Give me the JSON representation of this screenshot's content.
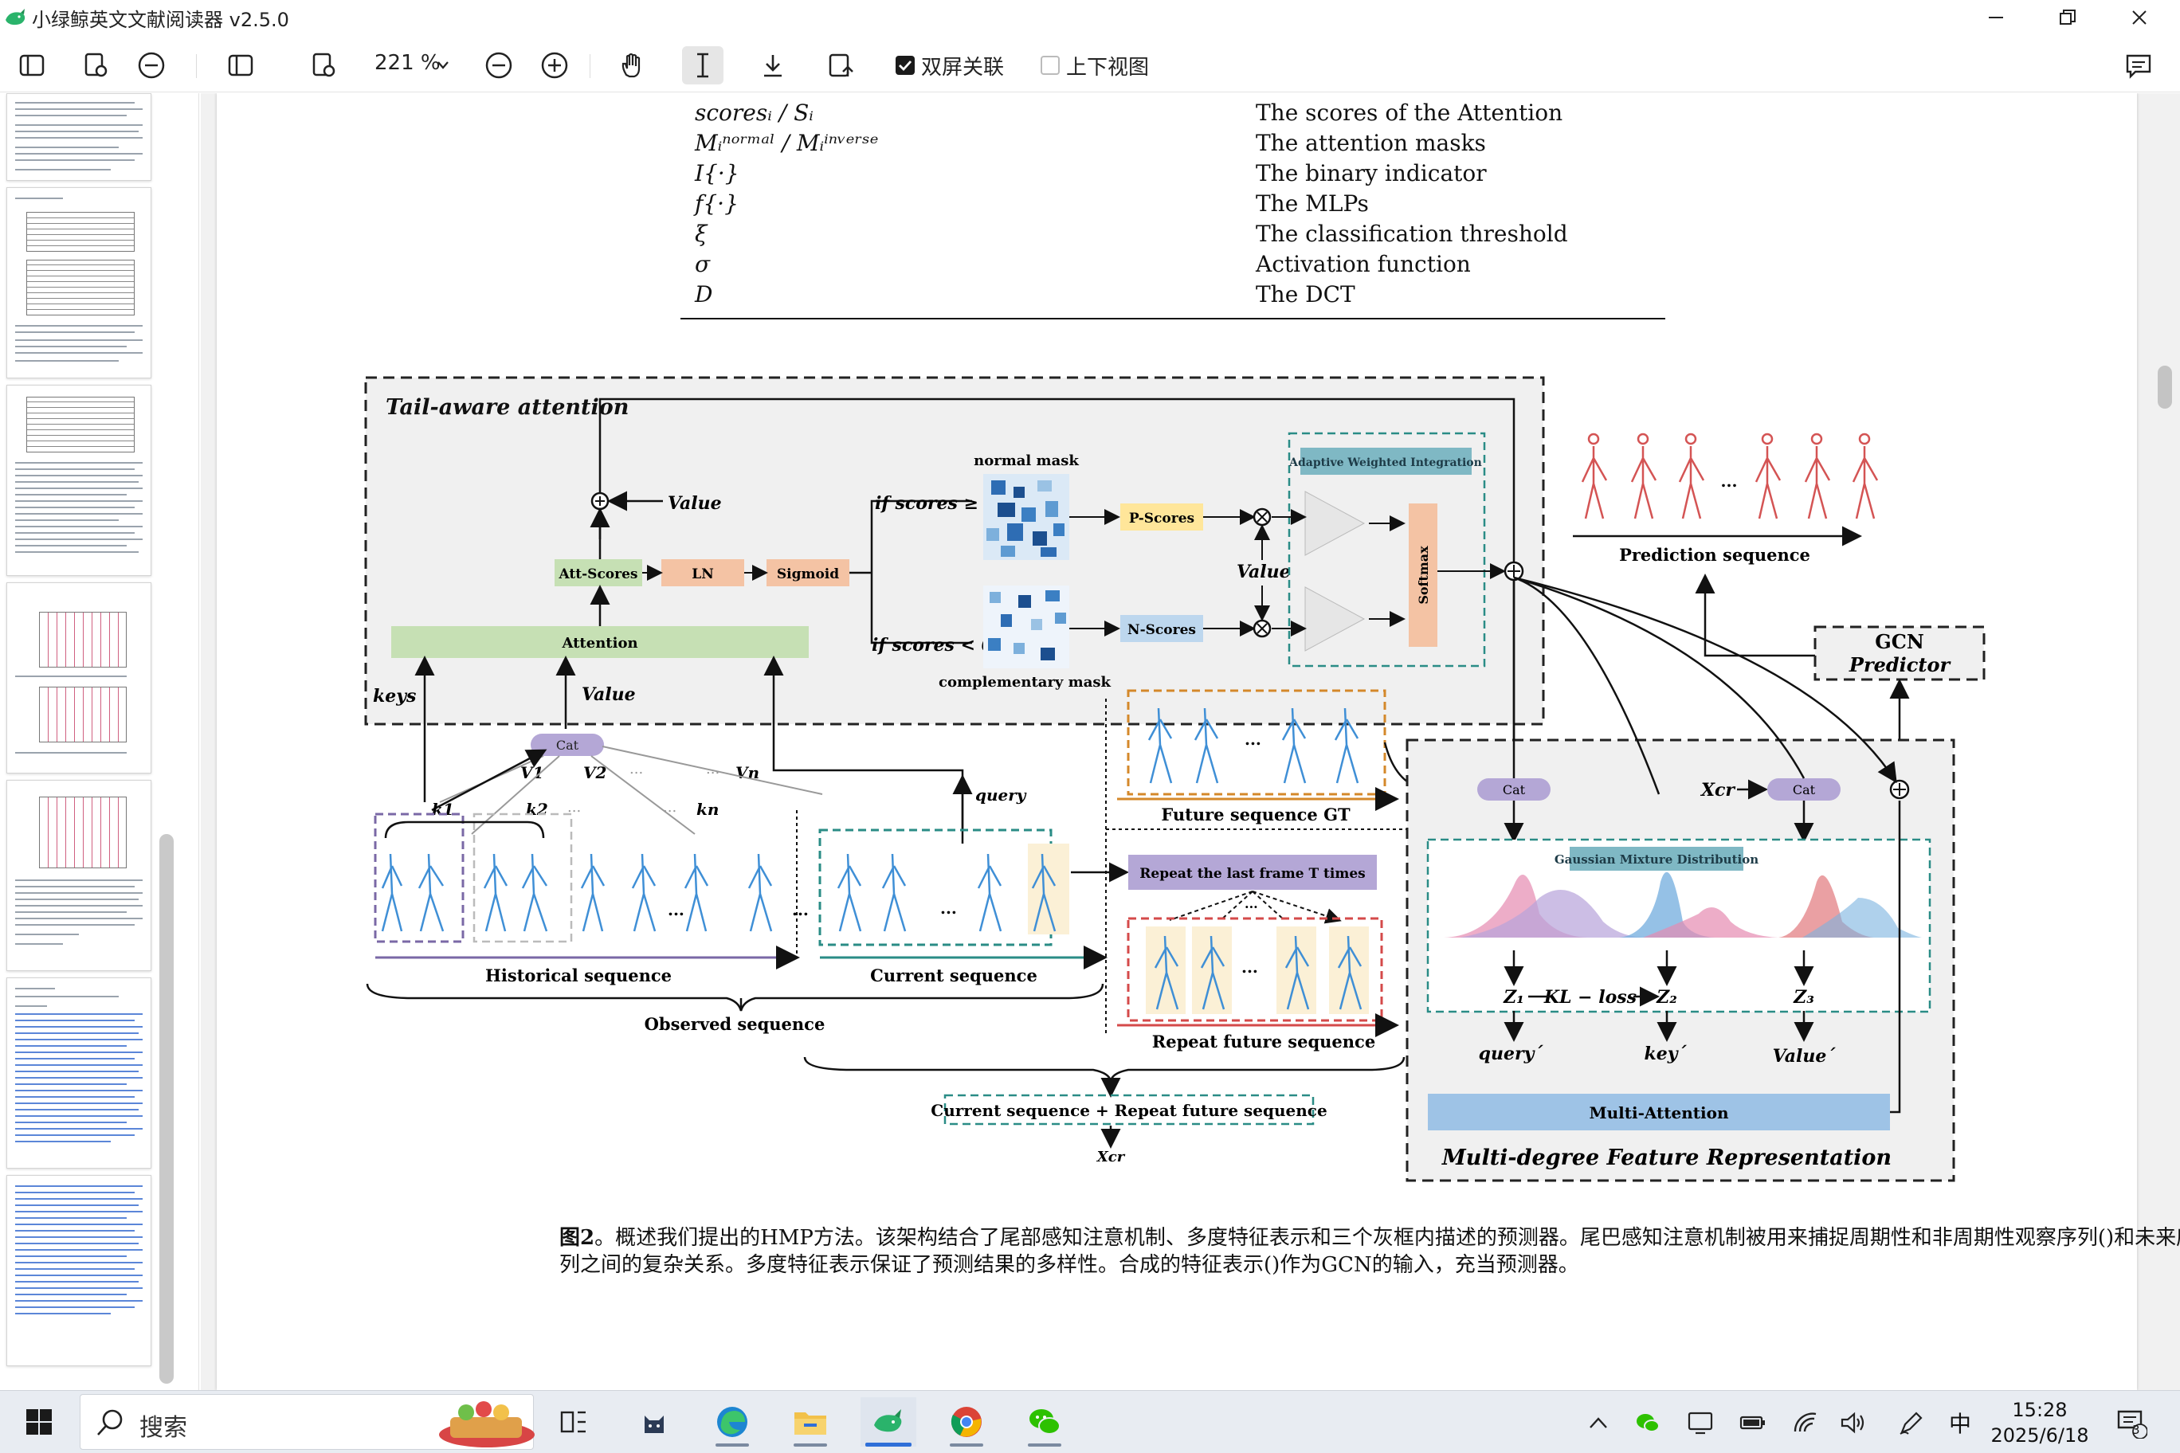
{
  "window": {
    "title": "小绿鲸英文文献阅读器 v2.5.0"
  },
  "toolbar": {
    "zoom": "221 %",
    "dual_screen_label": "双屏关联",
    "dual_screen_checked": true,
    "vertical_view_label": "上下视图",
    "vertical_view_checked": false
  },
  "notation_table": {
    "rows": [
      {
        "symbol": "scoresᵢ / Sᵢ",
        "meaning": "The scores of the Attention"
      },
      {
        "symbol": "Mᵢⁿᵒʳᵐᵃˡ / Mᵢⁱⁿᵛᵉʳˢᵉ",
        "meaning": "The attention masks"
      },
      {
        "symbol": "I{·}",
        "meaning": "The binary indicator"
      },
      {
        "symbol": "f{·}",
        "meaning": "The MLPs"
      },
      {
        "symbol": "ξ",
        "meaning": "The classification threshold"
      },
      {
        "symbol": "σ",
        "meaning": "Activation function"
      },
      {
        "symbol": "D",
        "meaning": "The DCT"
      }
    ]
  },
  "figure": {
    "tail_aware_title": "Tail-aware attention",
    "value": "Value",
    "att_scores": "Att-Scores",
    "ln": "LN",
    "sigmoid": "Sigmoid",
    "attention": "Attention",
    "cond_high": "if scores ≥ 0.3",
    "cond_low": "if scores < 0.3",
    "normal_mask": "normal mask",
    "complementary_mask": "complementary mask",
    "p_scores": "P-Scores",
    "n_scores": "N-Scores",
    "adaptive": "Adaptive Weighted Integration",
    "softmax": "Softmax",
    "prediction_sequence": "Prediction sequence",
    "gcn_predictor_1": "GCN",
    "gcn_predictor_2": "Predictor",
    "keys": "keys",
    "value2": "Value",
    "cat": "Cat",
    "v1": "V1",
    "v2": "V2",
    "vn": "Vn",
    "k1": "k1",
    "k2": "k2",
    "kn": "kn",
    "dots": "...",
    "query": "query",
    "future_gt": "Future sequence GT",
    "repeat_last": "Repeat the last frame T times",
    "repeat_future": "Repeat future sequence",
    "historical": "Historical sequence",
    "current": "Current sequence",
    "observed": "Observed sequence",
    "current_repeat_box": "Current sequence + Repeat future sequence",
    "xcr": "Xcr",
    "xcr2": "Xcr",
    "gmd": "Gaussian Mixture Distribution",
    "z1": "Z₁",
    "kl": "KL − loss",
    "z2": "Z₂",
    "z3": "Z₃",
    "query_p": "query´",
    "key_p": "key´",
    "value_p": "Value´",
    "multi_attention": "Multi-Attention",
    "mdfr": "Multi-degree Feature Representation"
  },
  "caption": {
    "label": "图2",
    "text": "。概述我们提出的HMP方法。该架构结合了尾部感知注意机制、多度特征表示和三个灰框内描述的预测器。尾巴感知注意机制被用来捕捉周期性和非周期性观察序列()和未来序列之间的复杂关系。多度特征表示保证了预测结果的多样性。合成的特征表示()作为GCN的输入，充当预测器。"
  },
  "taskbar": {
    "search_placeholder": "搜索",
    "time": "15:28",
    "date": "2025/6/18",
    "ime": "中",
    "notification_count": "3"
  }
}
